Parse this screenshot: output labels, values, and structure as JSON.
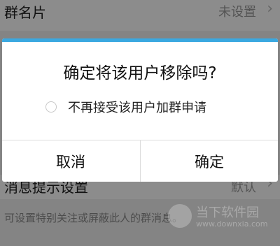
{
  "background": {
    "group_card": {
      "label": "群名片",
      "value": "未设置",
      "chevron": "›"
    },
    "notify_settings": {
      "label": "消息提示设置",
      "value": "默认",
      "chevron": "›"
    },
    "hint": "可设置特别关注或屏蔽此人的群消息。"
  },
  "dialog": {
    "title": "确定将该用户移除吗?",
    "option_label": "不再接受该用户加群申请",
    "option_checked": false,
    "cancel_label": "取消",
    "confirm_label": "确定"
  },
  "watermark": {
    "name": "当下软件园",
    "url": "www.downxia.com"
  },
  "colors": {
    "accent": "#3aa8e0"
  }
}
